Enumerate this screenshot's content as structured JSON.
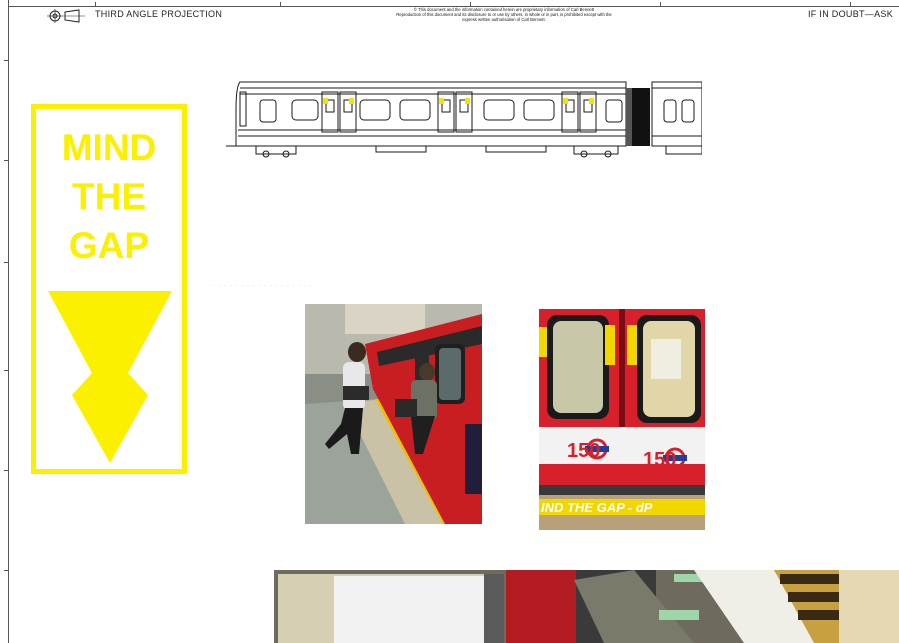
{
  "title_block": {
    "projection": "THIRD ANGLE PROJECTION",
    "doubt_note": "IF IN DOUBT—ASK",
    "notice_line1": "© This document and the information contained herein are proprietary information of Carl Bennett",
    "notice_line2": "Reproduction of this document and its disclosure to or use by others, in whole or in part, is prohibited except with the",
    "notice_line3": "express written authorisation of Carl Bennett."
  },
  "sign": {
    "line1": "MIND",
    "line2": "THE",
    "line3": "GAP",
    "color": "#fbf000"
  },
  "photos": {
    "doors_roundel_1": "150",
    "doors_roundel_2": "150",
    "doors_platform_text": "IND THE GAP - dP"
  },
  "colors": {
    "train_red": "#d8202c",
    "warning_yellow": "#f2d600",
    "drawing_line": "#1a1a1a"
  }
}
